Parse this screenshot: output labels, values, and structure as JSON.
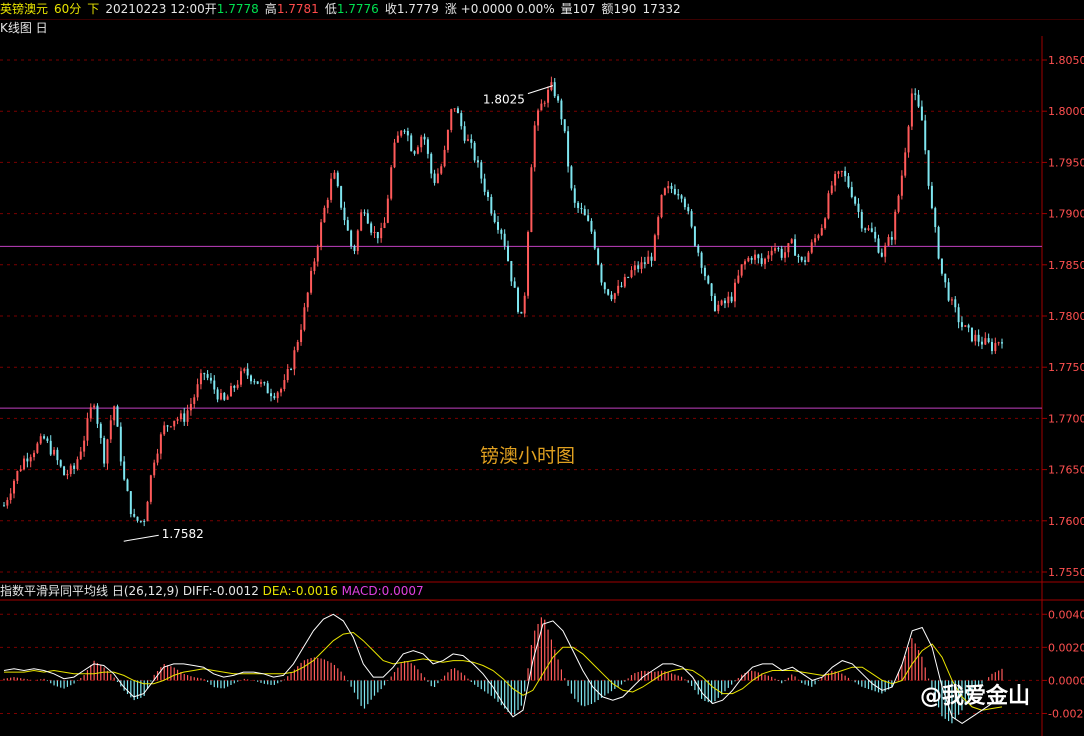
{
  "header": {
    "symbol": "英镑澳元",
    "period": "60分",
    "direction": "下",
    "date_open_label": "20210223 12:00开",
    "open": "1.7778",
    "high_label": "高",
    "high": "1.7781",
    "low_label": "低",
    "low": "1.7776",
    "close_label": "收1.7779",
    "change": "涨 +0.0000 0.00%",
    "volume": "量107",
    "amount": "额190",
    "extra": "17332"
  },
  "kline_label": "K线图 日",
  "macd_header": {
    "name": "指数平滑异同平均线 日(26,12,9)",
    "diff": "DIFF:-0.0012",
    "dea": "DEA:-0.0016",
    "macd": "MACD:0.0007"
  },
  "annotations": {
    "center_text": "镑澳小时图",
    "low_label": "1.7582",
    "high_label": "1.8025"
  },
  "watermark": "@我爱金山",
  "colors": {
    "up": "#ff5a5a",
    "down": "#7fe6f0",
    "grid": "#7a0000",
    "hline": "#c040c0",
    "dea": "#e8e400",
    "diff": "#ffffff",
    "label": "#e0a020"
  },
  "chart_data": [
    {
      "type": "line",
      "title": "",
      "ylim": [
        1.755,
        1.805
      ],
      "yticks": [
        "1.8050",
        "1.8000",
        "1.7950",
        "1.7900",
        "1.7850",
        "1.7800",
        "1.7750",
        "1.7700",
        "1.7650",
        "1.7600",
        "1.7550"
      ],
      "hlines": [
        1.7868,
        1.771
      ],
      "x": [
        0,
        10,
        20,
        30,
        40,
        50,
        60,
        70,
        80,
        90,
        100,
        110,
        120,
        130,
        140,
        150,
        160,
        170,
        180,
        190,
        200,
        210,
        220,
        230,
        240,
        250,
        260,
        270,
        280,
        290,
        300,
        310,
        320,
        330,
        340,
        350,
        360,
        370,
        380,
        390,
        400,
        410,
        420,
        430,
        440,
        450,
        460,
        470,
        480,
        490,
        500,
        510,
        520,
        530,
        540,
        550,
        560,
        570,
        580,
        590,
        600,
        610,
        620,
        630,
        640,
        650,
        660,
        670,
        680,
        690,
        700,
        710,
        720,
        730,
        740,
        750,
        760,
        770,
        780,
        790,
        800,
        810,
        820,
        830,
        840,
        850,
        860,
        870,
        880,
        890,
        900,
        910,
        920,
        930,
        940,
        950,
        960,
        970,
        980,
        990,
        1000
      ],
      "values": [
        1.7615,
        1.764,
        1.766,
        1.767,
        1.768,
        1.7665,
        1.7645,
        1.765,
        1.768,
        1.772,
        1.766,
        1.7715,
        1.764,
        1.76,
        1.76,
        1.766,
        1.769,
        1.77,
        1.77,
        1.772,
        1.7745,
        1.773,
        1.7715,
        1.773,
        1.7745,
        1.774,
        1.773,
        1.7725,
        1.773,
        1.776,
        1.78,
        1.785,
        1.79,
        1.794,
        1.79,
        1.786,
        1.791,
        1.788,
        1.788,
        1.796,
        1.799,
        1.796,
        1.798,
        1.793,
        1.795,
        1.801,
        1.798,
        1.796,
        1.793,
        1.79,
        1.788,
        1.783,
        1.779,
        1.798,
        1.801,
        1.8025,
        1.799,
        1.791,
        1.79,
        1.788,
        1.783,
        1.782,
        1.783,
        1.7845,
        1.785,
        1.786,
        1.792,
        1.7925,
        1.792,
        1.788,
        1.785,
        1.781,
        1.781,
        1.782,
        1.785,
        1.786,
        1.785,
        1.787,
        1.786,
        1.787,
        1.785,
        1.787,
        1.789,
        1.793,
        1.794,
        1.792,
        1.789,
        1.788,
        1.786,
        1.788,
        1.794,
        1.802,
        1.799,
        1.79,
        1.784,
        1.781,
        1.779,
        1.778,
        1.7775,
        1.777,
        1.7779
      ],
      "low_point": 1.7582,
      "high_point": 1.8025
    },
    {
      "type": "bar",
      "title": "指数平滑异同平均线",
      "ylim": [
        -0.003,
        0.0045
      ],
      "yticks": [
        "0.0040",
        "0.0020",
        "0.0000",
        "-0.0020"
      ],
      "x": [
        0,
        10,
        20,
        30,
        40,
        50,
        60,
        70,
        80,
        90,
        100,
        110,
        120,
        130,
        140,
        150,
        160,
        170,
        180,
        190,
        200,
        210,
        220,
        230,
        240,
        250,
        260,
        270,
        280,
        290,
        300,
        310,
        320,
        330,
        340,
        350,
        360,
        370,
        380,
        390,
        400,
        410,
        420,
        430,
        440,
        450,
        460,
        470,
        480,
        490,
        500,
        510,
        520,
        530,
        540,
        550,
        560,
        570,
        580,
        590,
        600,
        610,
        620,
        630,
        640,
        650,
        660,
        670,
        680,
        690,
        700,
        710,
        720,
        730,
        740,
        750,
        760,
        770,
        780,
        790,
        800,
        810,
        820,
        830,
        840,
        850,
        860,
        870,
        880,
        890,
        900,
        910,
        920,
        930,
        940,
        950,
        960,
        970,
        980,
        990,
        1000
      ],
      "macd": [
        0.0001,
        0.0002,
        0.0001,
        0.0,
        0.0001,
        -0.0003,
        -0.0005,
        -0.0002,
        0.0003,
        0.0012,
        0.0008,
        0.0002,
        -0.0006,
        -0.0012,
        -0.001,
        0.0003,
        0.001,
        0.0008,
        0.0004,
        0.0002,
        0.0001,
        -0.0004,
        -0.0005,
        -0.0002,
        0.0001,
        0.0,
        -0.0002,
        -0.0003,
        0.0,
        0.0006,
        0.0012,
        0.0014,
        0.0013,
        0.001,
        0.0004,
        -0.0006,
        -0.0018,
        -0.001,
        -0.0004,
        0.0004,
        0.0012,
        0.001,
        0.0003,
        -0.0005,
        0.0002,
        0.0008,
        0.0004,
        -0.0002,
        -0.0006,
        -0.001,
        -0.0016,
        -0.0022,
        -0.0014,
        0.0028,
        0.004,
        0.0022,
        0.0004,
        -0.001,
        -0.0016,
        -0.0014,
        -0.001,
        -0.0006,
        -0.0002,
        0.0004,
        0.0006,
        0.0005,
        0.0006,
        0.0004,
        0.0002,
        -0.0004,
        -0.0012,
        -0.0014,
        -0.0008,
        -0.0002,
        0.0004,
        0.0006,
        0.0004,
        0.0002,
        -0.0002,
        0.0004,
        -0.0002,
        -0.0004,
        0.0002,
        0.0006,
        0.0004,
        0.0,
        -0.0004,
        -0.0006,
        -0.0008,
        -0.0004,
        0.001,
        0.0026,
        0.0014,
        -0.0006,
        -0.0022,
        -0.0026,
        -0.0018,
        -0.0008,
        -0.0002,
        0.0004,
        0.0007
      ],
      "diff": [
        0.0006,
        0.0007,
        0.0006,
        0.0007,
        0.0006,
        0.0004,
        0.0001,
        0.0002,
        0.0006,
        0.001,
        0.0009,
        0.0004,
        -0.0004,
        -0.001,
        -0.0008,
        0.0,
        0.0008,
        0.001,
        0.001,
        0.0009,
        0.0008,
        0.0004,
        0.0002,
        0.0003,
        0.0005,
        0.0005,
        0.0004,
        0.0002,
        0.0003,
        0.001,
        0.002,
        0.003,
        0.0037,
        0.004,
        0.0036,
        0.0026,
        0.001,
        0.0002,
        0.0002,
        0.0008,
        0.0016,
        0.0018,
        0.0016,
        0.001,
        0.0012,
        0.0016,
        0.0015,
        0.001,
        0.0004,
        -0.0004,
        -0.0014,
        -0.0022,
        -0.0018,
        0.0012,
        0.0034,
        0.0036,
        0.003,
        0.0018,
        0.0006,
        -0.0004,
        -0.001,
        -0.0012,
        -0.001,
        -0.0004,
        0.0002,
        0.0006,
        0.001,
        0.001,
        0.0008,
        0.0002,
        -0.0008,
        -0.0014,
        -0.0012,
        -0.0006,
        0.0002,
        0.0008,
        0.001,
        0.001,
        0.0006,
        0.0008,
        0.0004,
        0.0,
        0.0002,
        0.0008,
        0.0012,
        0.001,
        0.0004,
        -0.0002,
        -0.0006,
        -0.0004,
        0.001,
        0.003,
        0.0032,
        0.002,
        -0.0004,
        -0.0022,
        -0.0026,
        -0.0022,
        -0.0018,
        -0.0014,
        -0.0012
      ],
      "dea": [
        0.0005,
        0.0005,
        0.0005,
        0.0006,
        0.0005,
        0.0006,
        0.0005,
        0.0004,
        0.0004,
        0.0004,
        0.0005,
        0.0005,
        0.0003,
        0.0,
        -0.0002,
        -0.0002,
        0.0,
        0.0003,
        0.0005,
        0.0006,
        0.0007,
        0.0006,
        0.0005,
        0.0004,
        0.0004,
        0.0004,
        0.0004,
        0.0004,
        0.0004,
        0.0005,
        0.0008,
        0.0012,
        0.0018,
        0.0024,
        0.0028,
        0.0029,
        0.0024,
        0.0018,
        0.0012,
        0.001,
        0.0011,
        0.0012,
        0.0013,
        0.0012,
        0.0011,
        0.0012,
        0.0012,
        0.0011,
        0.0009,
        0.0006,
        0.0001,
        -0.0005,
        -0.0009,
        -0.0006,
        0.0004,
        0.0014,
        0.002,
        0.002,
        0.0016,
        0.001,
        0.0004,
        -0.0002,
        -0.0006,
        -0.0007,
        -0.0004,
        0.0,
        0.0004,
        0.0006,
        0.0007,
        0.0006,
        0.0002,
        -0.0004,
        -0.0008,
        -0.0008,
        -0.0005,
        0.0,
        0.0004,
        0.0006,
        0.0006,
        0.0006,
        0.0005,
        0.0004,
        0.0003,
        0.0004,
        0.0006,
        0.0008,
        0.0008,
        0.0004,
        0.0,
        -0.0002,
        0.0,
        0.001,
        0.0018,
        0.0022,
        0.0014,
        0.0,
        -0.001,
        -0.0016,
        -0.0018,
        -0.0017,
        -0.0016
      ]
    }
  ]
}
